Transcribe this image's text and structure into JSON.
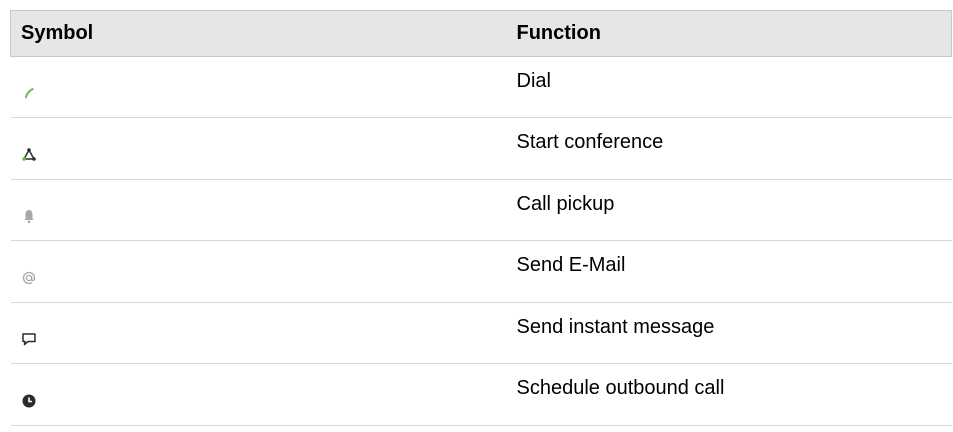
{
  "table": {
    "headers": {
      "symbol": "Symbol",
      "function": "Function"
    },
    "rows": [
      {
        "icon": "phone-icon",
        "function": "Dial"
      },
      {
        "icon": "conference-icon",
        "function": "Start conference"
      },
      {
        "icon": "bell-icon",
        "function": "Call pickup"
      },
      {
        "icon": "at-sign-icon",
        "function": "Send E-Mail"
      },
      {
        "icon": "chat-bubble-icon",
        "function": "Send instant message"
      },
      {
        "icon": "clock-icon",
        "function": "Schedule outbound call"
      }
    ]
  },
  "colors": {
    "header_bg": "#e6e6e6",
    "phone": "#6abf4b",
    "icon_dark": "#2b2b2b",
    "icon_gray": "#a8a8a8"
  }
}
